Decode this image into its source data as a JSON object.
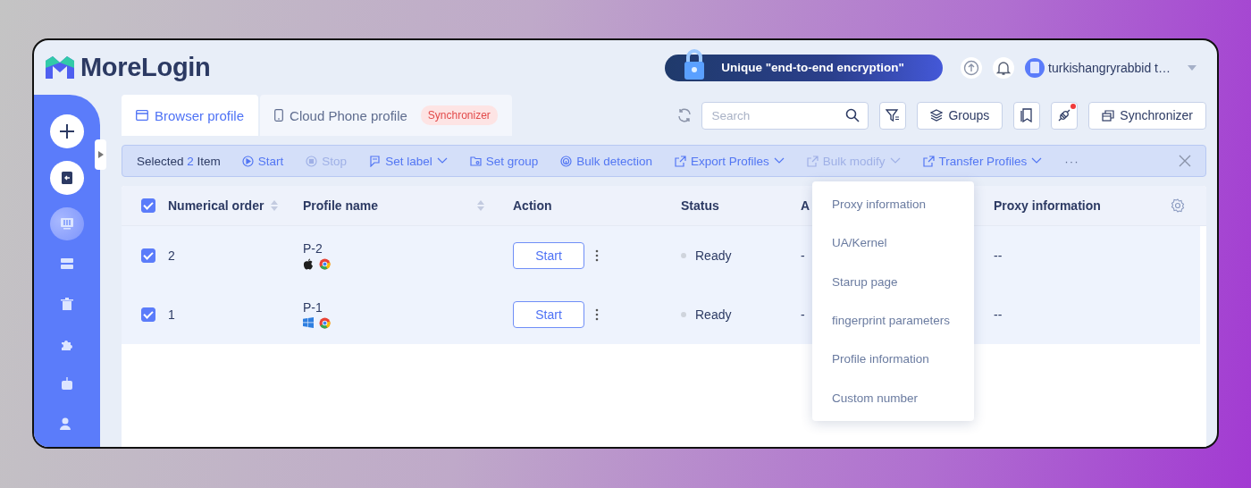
{
  "header": {
    "logo": "MoreLogin",
    "promo": "Unique \"end-to-end encryption\"",
    "username": "turkishangryrabbid t…"
  },
  "sidebar": {
    "items": [
      {
        "kind": "circle",
        "selected": false
      },
      {
        "kind": "circle",
        "selected": false
      },
      {
        "kind": "nav",
        "selected": true
      },
      {
        "kind": "nav",
        "selected": false
      },
      {
        "kind": "nav",
        "selected": false
      },
      {
        "kind": "nav",
        "selected": false
      },
      {
        "kind": "nav",
        "selected": false
      },
      {
        "kind": "nav",
        "selected": false
      }
    ]
  },
  "tabs": [
    {
      "label": "Browser profile",
      "selected": true
    },
    {
      "label": "Cloud Phone profile",
      "selected": false,
      "badge": "Synchronizer"
    }
  ],
  "toolbar": {
    "search": {
      "placeholder": "Search"
    },
    "groups": "Groups",
    "synchronizer": "Synchronizer",
    "plugin_notification": true
  },
  "selection_bar": {
    "prefix": "Selected",
    "count": "2",
    "suffix": "Item",
    "more": "···",
    "actions": [
      {
        "label": "Start",
        "disabled": false,
        "dropdown": false
      },
      {
        "label": "Stop",
        "disabled": true,
        "dropdown": false
      },
      {
        "label": "Set label",
        "disabled": false,
        "dropdown": true
      },
      {
        "label": "Set group",
        "disabled": false,
        "dropdown": false
      },
      {
        "label": "Bulk detection",
        "disabled": false,
        "dropdown": false
      },
      {
        "label": "Export Profiles",
        "disabled": false,
        "dropdown": true
      },
      {
        "label": "Bulk modify",
        "disabled": true,
        "dropdown": true
      },
      {
        "label": "Transfer Profiles",
        "disabled": false,
        "dropdown": true
      }
    ]
  },
  "table": {
    "all_checked": true,
    "columns": [
      {
        "label": "Numerical order",
        "sortable": true
      },
      {
        "label": "Profile name",
        "sortable": true
      },
      {
        "label": "Action",
        "sortable": false
      },
      {
        "label": "Status",
        "sortable": false
      },
      {
        "label": "A"
      },
      {
        "label": "Proxy information",
        "sortable": false
      }
    ],
    "rows": [
      {
        "checked": true,
        "order": "2",
        "name": "P-2",
        "kind": "macos",
        "action": "Start",
        "status": "Ready",
        "column_5": "-",
        "proxy": "--"
      },
      {
        "checked": true,
        "order": "1",
        "name": "P-1",
        "kind": "windows",
        "action": "Start",
        "status": "Ready",
        "column_5": "-",
        "proxy": "--"
      }
    ]
  },
  "dropdown": {
    "items": [
      "Proxy information",
      "UA/Kernel",
      "Starup page",
      "fingerprint parameters",
      "Profile information",
      "Custom number"
    ]
  }
}
